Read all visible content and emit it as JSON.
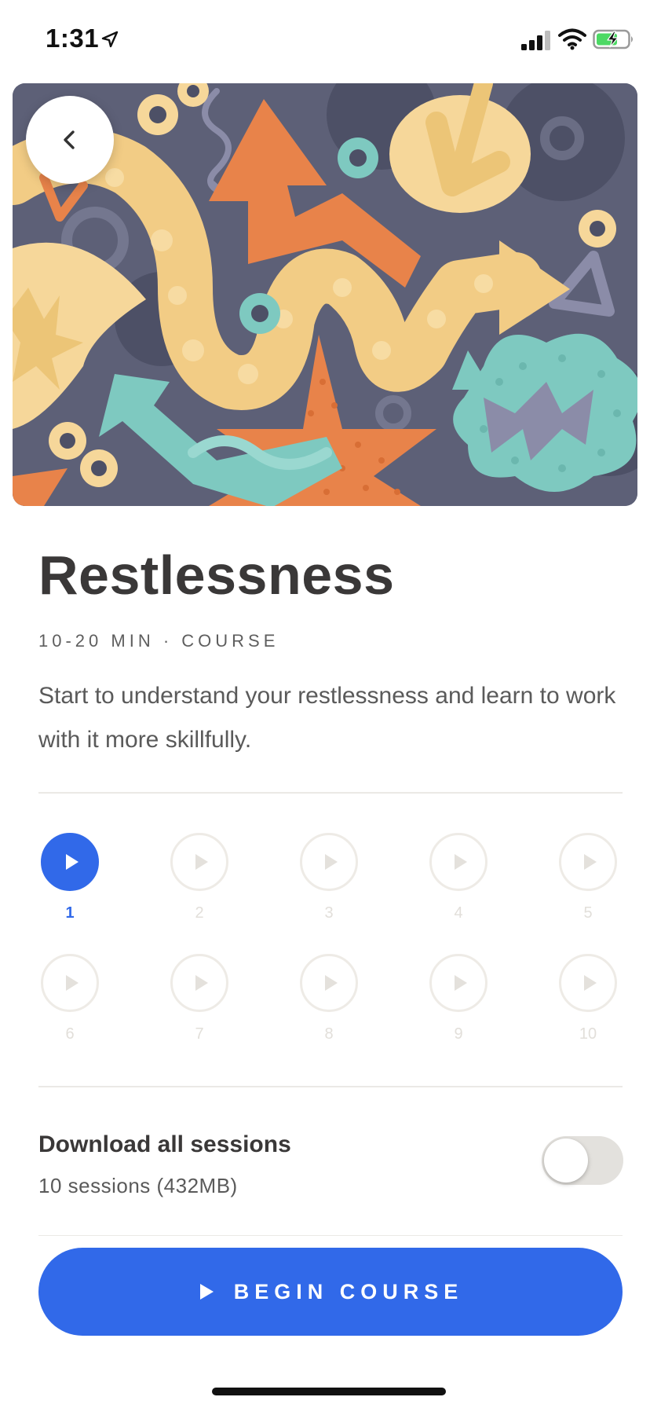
{
  "status_bar": {
    "time": "1:31",
    "icons": [
      "location-arrow-icon",
      "cellular-signal-icon",
      "wifi-icon",
      "battery-charging-icon"
    ]
  },
  "hero": {
    "illustration": "abstract-arrows-illustration",
    "colors": {
      "background": "#5d6077",
      "orange": "#e8834a",
      "yellow": "#f6d79a",
      "teal": "#7ec9c0",
      "lavender": "#8b8ca8"
    },
    "back_icon": "chevron-left-icon"
  },
  "course": {
    "title": "Restlessness",
    "meta": "10-20 MIN · COURSE",
    "description": "Start to understand your restlessness and learn to work with it more skillfully."
  },
  "sessions": [
    {
      "label": "1",
      "active": true
    },
    {
      "label": "2",
      "active": false
    },
    {
      "label": "3",
      "active": false
    },
    {
      "label": "4",
      "active": false
    },
    {
      "label": "5",
      "active": false
    },
    {
      "label": "6",
      "active": false
    },
    {
      "label": "7",
      "active": false
    },
    {
      "label": "8",
      "active": false
    },
    {
      "label": "9",
      "active": false
    },
    {
      "label": "10",
      "active": false
    }
  ],
  "download": {
    "title": "Download all sessions",
    "subtitle": "10 sessions (432MB)",
    "enabled": false
  },
  "begin_button": {
    "label": "BEGIN COURSE",
    "icon": "play-icon"
  },
  "theme": {
    "accent": "#3169e9",
    "inactive_circle": "#eeebe6",
    "text_dark": "#3a3838"
  }
}
